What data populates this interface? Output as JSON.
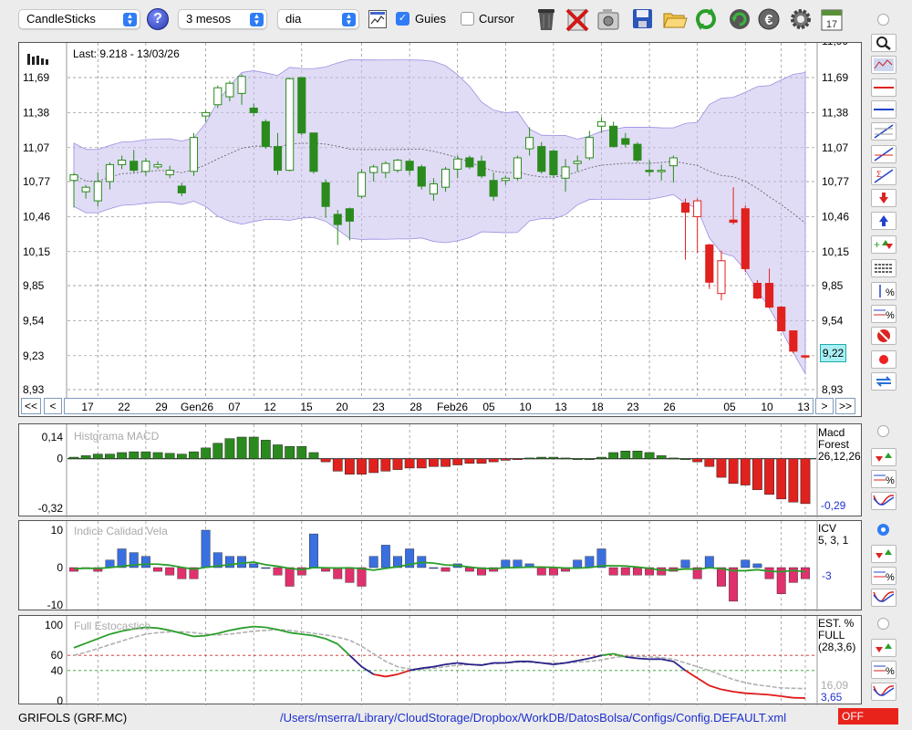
{
  "toolbar": {
    "chart_type": "CandleSticks",
    "help": "?",
    "period": "3 mesos",
    "interval": "dia",
    "guies_label": "Guies",
    "guies_checked": true,
    "cursor_label": "Cursor",
    "cursor_checked": false,
    "icons": [
      "trash-icon",
      "delete-icon",
      "image-icon",
      "save-icon",
      "folder-icon",
      "refresh-icon",
      "update-icon",
      "currency-icon",
      "gear-icon",
      "calendar-icon"
    ],
    "calendar_day": "17"
  },
  "main": {
    "last_label": "Last: 9.218 - 13/03/26",
    "y_ticks": [
      "11,69",
      "11,38",
      "11,07",
      "10,77",
      "10,46",
      "10,15",
      "9,85",
      "9,54",
      "9,23",
      "8,93"
    ],
    "y_top_cut": "11,99",
    "current_value": "9,22",
    "x_ticks": [
      "17",
      "22",
      "29",
      "Gen26",
      "07",
      "12",
      "15",
      "20",
      "23",
      "28",
      "Feb26",
      "05",
      "10",
      "13",
      "18",
      "23",
      "26",
      "05",
      "10",
      "13"
    ],
    "nav": {
      "first": "<<",
      "prev": "<",
      "next": ">",
      "last": ">>"
    }
  },
  "macd": {
    "title": "Histgrama MACD",
    "name": "Macd",
    "sub": "Forest",
    "params": "26,12,26",
    "y_ticks": [
      "0,14",
      "0",
      "-0,32"
    ],
    "value": "-0,29"
  },
  "icv": {
    "title": "Indice Calidad Vela",
    "name": "ICV",
    "params": "5, 3, 1",
    "y_ticks": [
      "10",
      "0",
      "-10"
    ],
    "value": "-3"
  },
  "stoch": {
    "title": "Full Estocastico",
    "name": "EST. %",
    "sub": "FULL",
    "params": "(28,3,6)",
    "y_ticks": [
      "100",
      "60",
      "40",
      "0"
    ],
    "value1": "16,09",
    "value2": "3,65"
  },
  "status": {
    "ticker": "GRIFOLS (GRF.MC)",
    "path": "/Users/mserra/Library/CloudStorage/Dropbox/WorkDB/DatosBolsa/Configs/Config.DEFAULT.xml",
    "off": "OFF"
  },
  "sidebar": {
    "tools": [
      "zoom-icon",
      "fit-icon",
      "horizontal-line-icon",
      "blue-line-icon",
      "fibonacci-icon",
      "trend-line-icon",
      "sum-line-icon",
      "sell-arrow-icon",
      "buy-arrow-icon",
      "add-signal-icon",
      "grid-lines-icon",
      "percent-range-icon",
      "percent-lines-icon",
      "stop-icon",
      "record-icon",
      "swap-icon"
    ],
    "radio_selected": 2
  },
  "colors": {
    "up": "#2b8a1e",
    "down": "#e0211e",
    "band": "#c9c0ee",
    "macd_up": "#2b8a1e",
    "icv_up": "#3a6fe0",
    "icv_down": "#e0306e",
    "stoch_k": "#2b8a1e",
    "stoch_d": "#b0b0b0"
  },
  "chart_data": {
    "type": "candlestick",
    "candles": [
      {
        "o": 10.78,
        "h": 10.85,
        "l": 10.54,
        "c": 10.83
      },
      {
        "o": 10.68,
        "h": 10.74,
        "l": 10.62,
        "c": 10.72
      },
      {
        "o": 10.6,
        "h": 10.85,
        "l": 10.55,
        "c": 10.77
      },
      {
        "o": 10.77,
        "h": 10.94,
        "l": 10.7,
        "c": 10.92
      },
      {
        "o": 10.92,
        "h": 11.0,
        "l": 10.88,
        "c": 10.96
      },
      {
        "o": 10.95,
        "h": 11.05,
        "l": 10.85,
        "c": 10.87
      },
      {
        "o": 10.86,
        "h": 10.98,
        "l": 10.82,
        "c": 10.95
      },
      {
        "o": 10.9,
        "h": 10.95,
        "l": 10.88,
        "c": 10.92
      },
      {
        "o": 10.83,
        "h": 10.91,
        "l": 10.8,
        "c": 10.87
      },
      {
        "o": 10.73,
        "h": 10.76,
        "l": 10.64,
        "c": 10.67
      },
      {
        "o": 10.86,
        "h": 11.2,
        "l": 10.82,
        "c": 11.16
      },
      {
        "o": 11.35,
        "h": 11.4,
        "l": 11.3,
        "c": 11.38
      },
      {
        "o": 11.45,
        "h": 11.62,
        "l": 11.42,
        "c": 11.6
      },
      {
        "o": 11.52,
        "h": 11.66,
        "l": 11.48,
        "c": 11.64
      },
      {
        "o": 11.55,
        "h": 11.72,
        "l": 11.45,
        "c": 11.7
      },
      {
        "o": 11.42,
        "h": 11.46,
        "l": 11.35,
        "c": 11.38
      },
      {
        "o": 11.3,
        "h": 11.32,
        "l": 11.06,
        "c": 11.08
      },
      {
        "o": 11.08,
        "h": 11.2,
        "l": 10.83,
        "c": 10.87
      },
      {
        "o": 10.87,
        "h": 11.69,
        "l": 10.86,
        "c": 11.68
      },
      {
        "o": 11.69,
        "h": 11.69,
        "l": 11.18,
        "c": 11.2
      },
      {
        "o": 11.2,
        "h": 11.2,
        "l": 10.84,
        "c": 10.86
      },
      {
        "o": 10.76,
        "h": 10.79,
        "l": 10.45,
        "c": 10.55
      },
      {
        "o": 10.48,
        "h": 10.52,
        "l": 10.21,
        "c": 10.39
      },
      {
        "o": 10.53,
        "h": 10.54,
        "l": 10.25,
        "c": 10.42
      },
      {
        "o": 10.64,
        "h": 10.88,
        "l": 10.62,
        "c": 10.85
      },
      {
        "o": 10.85,
        "h": 10.92,
        "l": 10.77,
        "c": 10.9
      },
      {
        "o": 10.85,
        "h": 10.95,
        "l": 10.8,
        "c": 10.93
      },
      {
        "o": 10.87,
        "h": 10.97,
        "l": 10.85,
        "c": 10.96
      },
      {
        "o": 10.95,
        "h": 10.97,
        "l": 10.83,
        "c": 10.87
      },
      {
        "o": 10.9,
        "h": 10.92,
        "l": 10.7,
        "c": 10.73
      },
      {
        "o": 10.66,
        "h": 10.8,
        "l": 10.6,
        "c": 10.75
      },
      {
        "o": 10.72,
        "h": 10.9,
        "l": 10.68,
        "c": 10.88
      },
      {
        "o": 10.88,
        "h": 11.0,
        "l": 10.8,
        "c": 10.97
      },
      {
        "o": 10.98,
        "h": 11.0,
        "l": 10.88,
        "c": 10.9
      },
      {
        "o": 10.95,
        "h": 11.0,
        "l": 10.8,
        "c": 10.82
      },
      {
        "o": 10.78,
        "h": 10.85,
        "l": 10.6,
        "c": 10.64
      },
      {
        "o": 10.78,
        "h": 10.82,
        "l": 10.74,
        "c": 10.8
      },
      {
        "o": 10.8,
        "h": 11.0,
        "l": 10.78,
        "c": 10.98
      },
      {
        "o": 11.06,
        "h": 11.25,
        "l": 11.0,
        "c": 11.16
      },
      {
        "o": 11.08,
        "h": 11.12,
        "l": 10.84,
        "c": 10.86
      },
      {
        "o": 11.04,
        "h": 11.05,
        "l": 10.8,
        "c": 10.83
      },
      {
        "o": 10.8,
        "h": 10.97,
        "l": 10.68,
        "c": 10.9
      },
      {
        "o": 10.93,
        "h": 11.0,
        "l": 10.86,
        "c": 10.95
      },
      {
        "o": 10.98,
        "h": 11.22,
        "l": 10.96,
        "c": 11.16
      },
      {
        "o": 11.26,
        "h": 11.34,
        "l": 11.2,
        "c": 11.3
      },
      {
        "o": 11.26,
        "h": 11.3,
        "l": 11.07,
        "c": 11.08
      },
      {
        "o": 11.15,
        "h": 11.2,
        "l": 11.07,
        "c": 11.1
      },
      {
        "o": 11.1,
        "h": 11.12,
        "l": 10.94,
        "c": 10.96
      },
      {
        "o": 10.87,
        "h": 10.96,
        "l": 10.82,
        "c": 10.86
      },
      {
        "o": 10.87,
        "h": 10.92,
        "l": 10.78,
        "c": 10.87
      },
      {
        "o": 10.91,
        "h": 11.0,
        "l": 10.76,
        "c": 10.98
      },
      {
        "o": 10.58,
        "h": 10.62,
        "l": 10.08,
        "c": 10.5
      },
      {
        "o": 10.46,
        "h": 10.62,
        "l": 10.14,
        "c": 10.6
      },
      {
        "o": 10.21,
        "h": 10.22,
        "l": 9.82,
        "c": 9.88
      },
      {
        "o": 9.78,
        "h": 10.16,
        "l": 9.72,
        "c": 10.07
      },
      {
        "o": 10.43,
        "h": 10.72,
        "l": 10.39,
        "c": 10.41
      },
      {
        "o": 10.53,
        "h": 10.56,
        "l": 9.97,
        "c": 10.0
      },
      {
        "o": 9.87,
        "h": 9.9,
        "l": 9.73,
        "c": 9.74
      },
      {
        "o": 9.87,
        "h": 10.0,
        "l": 9.65,
        "c": 9.66
      },
      {
        "o": 9.66,
        "h": 9.67,
        "l": 9.45,
        "c": 9.45
      },
      {
        "o": 9.45,
        "h": 9.44,
        "l": 9.25,
        "c": 9.27
      },
      {
        "o": 9.23,
        "h": 9.23,
        "l": 9.2,
        "c": 9.22
      }
    ],
    "macd_hist": [
      0.01,
      0.02,
      0.03,
      0.03,
      0.04,
      0.045,
      0.045,
      0.04,
      0.035,
      0.03,
      0.045,
      0.07,
      0.1,
      0.13,
      0.14,
      0.14,
      0.12,
      0.09,
      0.08,
      0.08,
      0.04,
      -0.02,
      -0.08,
      -0.1,
      -0.1,
      -0.09,
      -0.08,
      -0.07,
      -0.06,
      -0.06,
      -0.05,
      -0.05,
      -0.04,
      -0.03,
      -0.03,
      -0.02,
      -0.01,
      -0.005,
      0.005,
      0.01,
      0.01,
      0.005,
      0.0,
      0.0,
      0.01,
      0.04,
      0.05,
      0.05,
      0.04,
      0.02,
      0.005,
      0.0,
      -0.02,
      -0.05,
      -0.12,
      -0.16,
      -0.17,
      -0.2,
      -0.23,
      -0.26,
      -0.28,
      -0.29
    ],
    "icv": [
      -1,
      0,
      -1,
      2,
      5,
      4,
      3,
      -1,
      -2,
      -3,
      -3,
      10,
      4,
      3,
      3,
      1,
      0,
      -2,
      -5,
      -2,
      9,
      -1,
      -3,
      -4,
      -5,
      3,
      6,
      3,
      5,
      3,
      0,
      -1,
      1,
      -1,
      -2,
      -1,
      2,
      2,
      1,
      -2,
      -2,
      -1,
      2,
      3,
      5,
      -2,
      -2,
      -2,
      -2,
      -2,
      -1,
      2,
      -3,
      3,
      -5,
      -9,
      2,
      1,
      -3,
      -7,
      -4,
      -3
    ],
    "stoch_k": [
      70,
      76,
      82,
      88,
      92,
      95,
      97,
      96,
      93,
      89,
      85,
      86,
      89,
      93,
      96,
      98,
      97,
      94,
      90,
      88,
      86,
      82,
      75,
      60,
      45,
      35,
      32,
      35,
      40,
      43,
      45,
      48,
      50,
      48,
      47,
      50,
      50,
      52,
      52,
      50,
      48,
      50,
      53,
      56,
      60,
      62,
      58,
      56,
      55,
      55,
      52,
      40,
      30,
      20,
      15,
      12,
      10,
      9,
      8,
      6,
      4,
      3.65
    ],
    "stoch_d": [
      60,
      64,
      69,
      74,
      79,
      84,
      88,
      90,
      91,
      91,
      90,
      88,
      87,
      88,
      90,
      92,
      93,
      94,
      93,
      91,
      89,
      87,
      84,
      80,
      72,
      62,
      52,
      45,
      42,
      42,
      43,
      45,
      47,
      48,
      48,
      49,
      50,
      51,
      51,
      50,
      50,
      50,
      51,
      52,
      54,
      57,
      59,
      59,
      58,
      57,
      55,
      50,
      45,
      40,
      34,
      28,
      24,
      21,
      19,
      17,
      16.5,
      16.09
    ]
  }
}
